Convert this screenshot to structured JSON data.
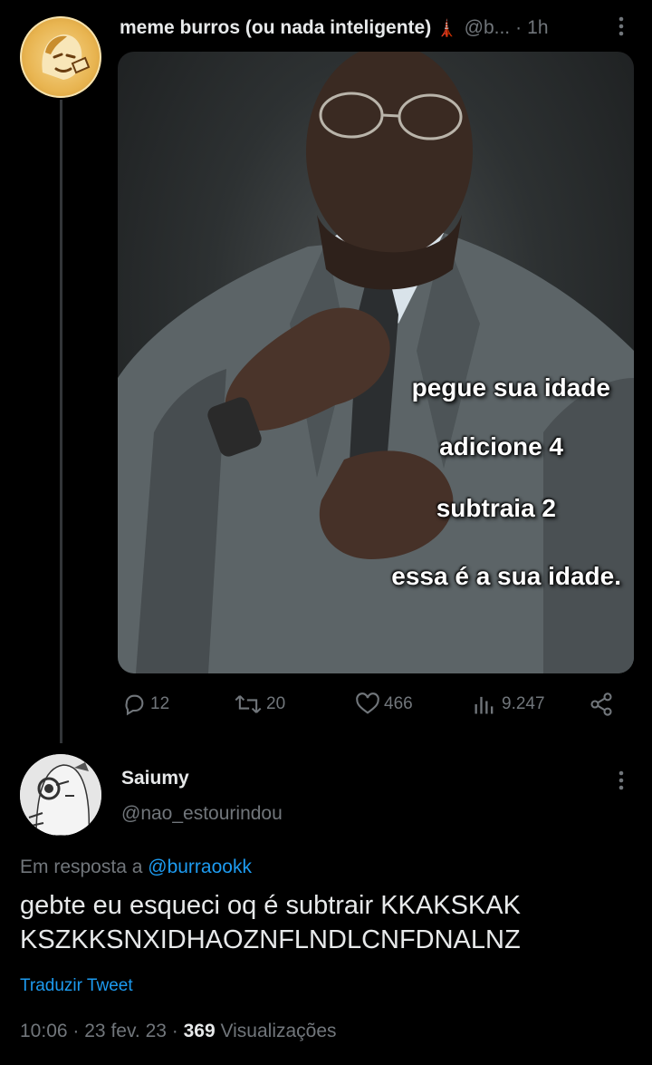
{
  "tweet": {
    "author_name": "meme burros (ou nada inteligente)",
    "author_emoji": "🗼",
    "author_handle": "@b...",
    "separator": "·",
    "time": "1h",
    "more_icon": "more-vertical-icon",
    "image_text": [
      "pegue sua idade",
      "adicione 4",
      "subtraia 2",
      "essa é a sua idade."
    ],
    "actions": {
      "replies": "12",
      "retweets": "20",
      "likes": "466",
      "views": "9.247"
    }
  },
  "reply": {
    "author_name": "Saiumy",
    "author_handle": "@nao_estourindou",
    "reply_prefix": "Em resposta a",
    "reply_to_handle": "@burraookk",
    "text": "gebte eu esqueci oq é subtrair KKAKSKAK KSZKKSNXIDHAOZNFLNDLCNFDNALNZ",
    "translate_label": "Traduzir Tweet",
    "time": "10:06",
    "date": "23 fev. 23",
    "separator": "·",
    "views_count": "369",
    "views_label": "Visualizações"
  },
  "colors": {
    "background": "#000000",
    "text": "#e7e9ea",
    "muted": "#71767b",
    "link": "#1d9bf0"
  }
}
